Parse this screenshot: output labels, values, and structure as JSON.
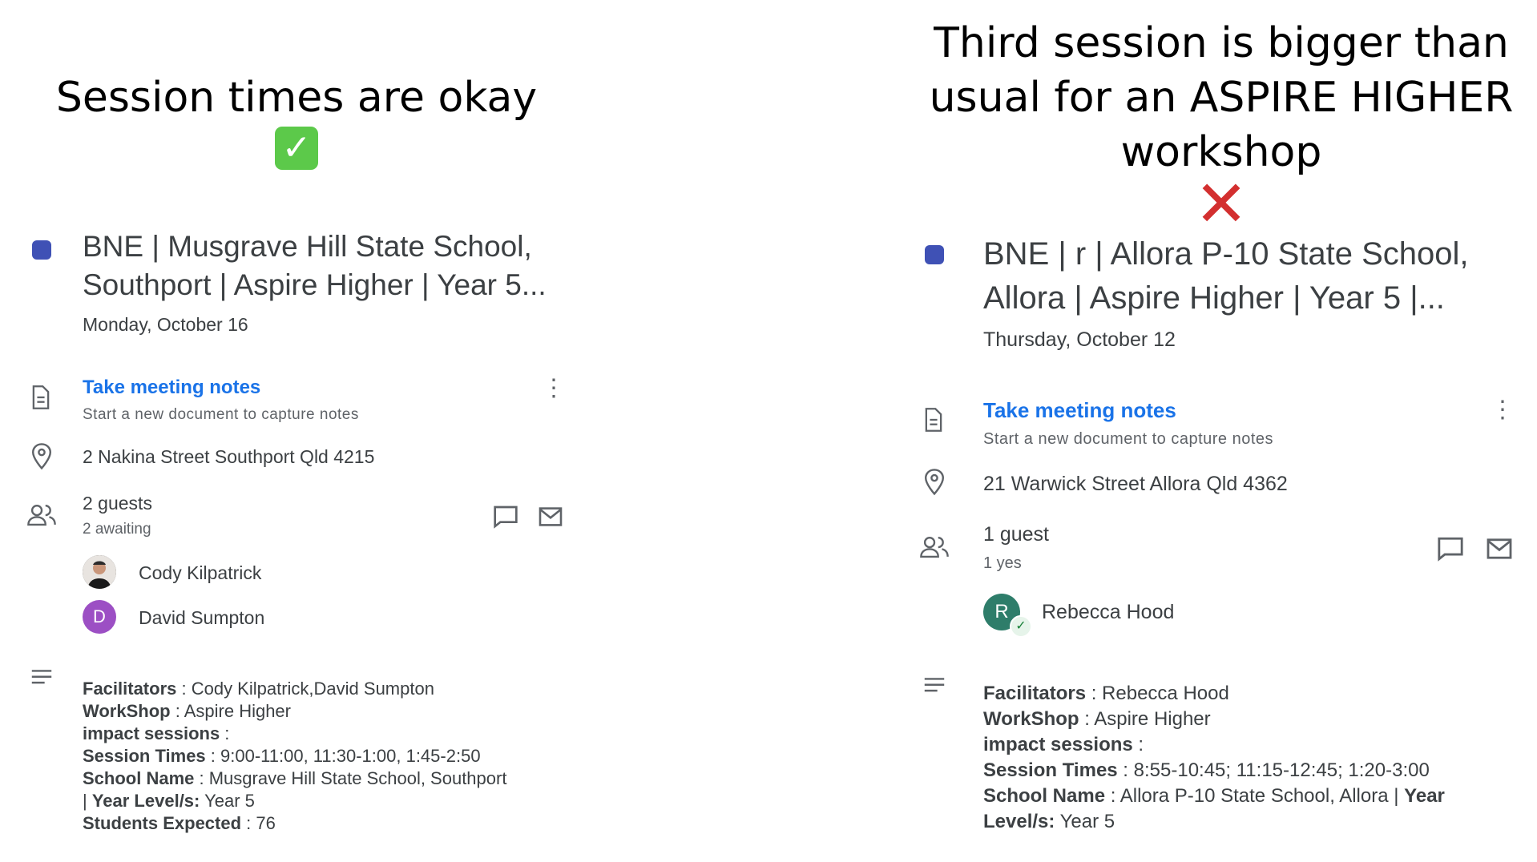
{
  "left": {
    "caption": "Session times are okay",
    "caption_mark": "✓",
    "title_line1": "BNE | Musgrave Hill State School,",
    "title_line2": "Southport | Aspire Higher | Year 5...",
    "date": "Monday, October 16",
    "notes_link": "Take meeting notes",
    "notes_sub": "Start a new document to capture notes",
    "address": "2 Nakina Street Southport Qld 4215",
    "guests_count": "2 guests",
    "guests_status": "2 awaiting",
    "guests": [
      {
        "name": "Cody Kilpatrick",
        "initial": ""
      },
      {
        "name": "David Sumpton",
        "initial": "D"
      }
    ],
    "desc": {
      "facilitators_label": "Facilitators",
      "facilitators_value": " : Cody Kilpatrick,David Sumpton",
      "workshop_label": "WorkShop",
      "workshop_value": " : Aspire Higher",
      "impact_label": "impact sessions",
      "impact_value": " :",
      "session_label": "Session Times",
      "session_value": " : 9:00-11:00, 11:30-1:00, 1:45-2:50",
      "school_label": "School Name",
      "school_value": " : Musgrave Hill State School, Southport",
      "year_prefix": "| ",
      "year_label": "Year Level/s:",
      "year_value": " Year 5",
      "students_label": "Students Expected",
      "students_value": " : 76"
    }
  },
  "right": {
    "caption_line1": "Third session is bigger than",
    "caption_line2": "usual for an ASPIRE HIGHER",
    "caption_line3": "workshop",
    "caption_mark": "✕",
    "title_line1": "BNE | r | Allora P-10 State School,",
    "title_line2": "Allora | Aspire Higher | Year 5 |...",
    "date": "Thursday, October 12",
    "notes_link": "Take meeting notes",
    "notes_sub": "Start a new document to capture notes",
    "address": "21 Warwick Street Allora Qld 4362",
    "guests_count": "1 guest",
    "guests_status": "1 yes",
    "guests": [
      {
        "name": "Rebecca Hood",
        "initial": "R"
      }
    ],
    "desc": {
      "facilitators_label": "Facilitators",
      "facilitators_value": " : Rebecca Hood",
      "workshop_label": "WorkShop",
      "workshop_value": " : Aspire Higher",
      "impact_label": "impact sessions",
      "impact_value": " :",
      "session_label": "Session Times",
      "session_value": " : 8:55-10:45; 11:15-12:45; 1:20-3:00",
      "school_label": "School Name",
      "school_value": " : Allora P-10 State School, Allora | ",
      "year_label_a": "Year",
      "year_label_b": "Level/s:",
      "year_value": " Year 5"
    }
  },
  "colors": {
    "event_dot": "#3f51b5",
    "link": "#1a73e8",
    "avatar_d": "#9c4fc4",
    "avatar_r": "#2e7d6a"
  }
}
